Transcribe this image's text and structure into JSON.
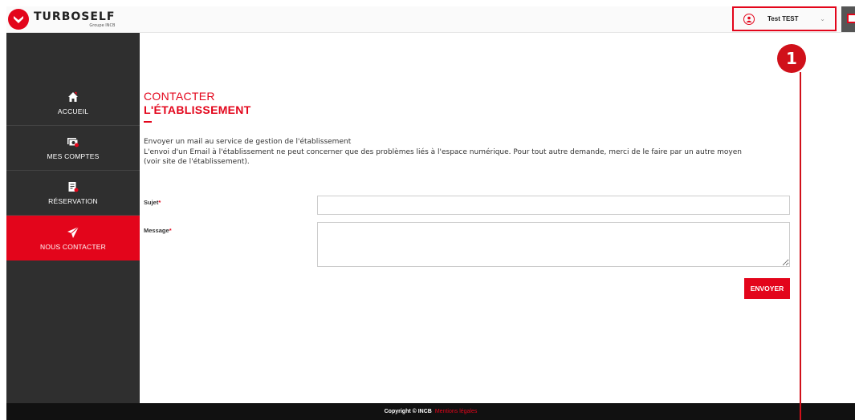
{
  "brand": {
    "name": "TURBOSELF",
    "subtitle": "Groupe INCB",
    "accent_color": "#e3051b"
  },
  "header": {
    "user_name": "Test TEST",
    "user_icon": "user-icon",
    "caret_icon": "chevron-down-icon"
  },
  "sidebar": {
    "items": [
      {
        "label": "ACCUEIL",
        "icon": "home-icon",
        "active": false
      },
      {
        "label": "MES COMPTES",
        "icon": "wallet-icon",
        "active": false
      },
      {
        "label": "RÉSERVATION",
        "icon": "reservation-icon",
        "active": false
      },
      {
        "label": "NOUS CONTACTER",
        "icon": "paper-plane-icon",
        "active": true
      }
    ]
  },
  "main": {
    "title_line1": "CONTACTER",
    "title_line2": "L'ÉTABLISSEMENT",
    "intro_line1": "Envoyer un mail au service de gestion de l'établissement",
    "intro_line2": "L'envoi d'un Email à l'établissement ne peut concerner que des problèmes liés à l'espace numérique. Pour tout autre demande, merci de le faire par un autre moyen",
    "intro_line3": "(voir site de l'établissement).",
    "subject_label": "Sujet",
    "message_label": "Message",
    "required_mark": "*",
    "subject_value": "",
    "message_value": "",
    "send_label": "ENVOYER"
  },
  "footer": {
    "copyright": "Copyright © INCB",
    "legal_link": "Mentions légales"
  },
  "annotation": {
    "number": "1"
  }
}
